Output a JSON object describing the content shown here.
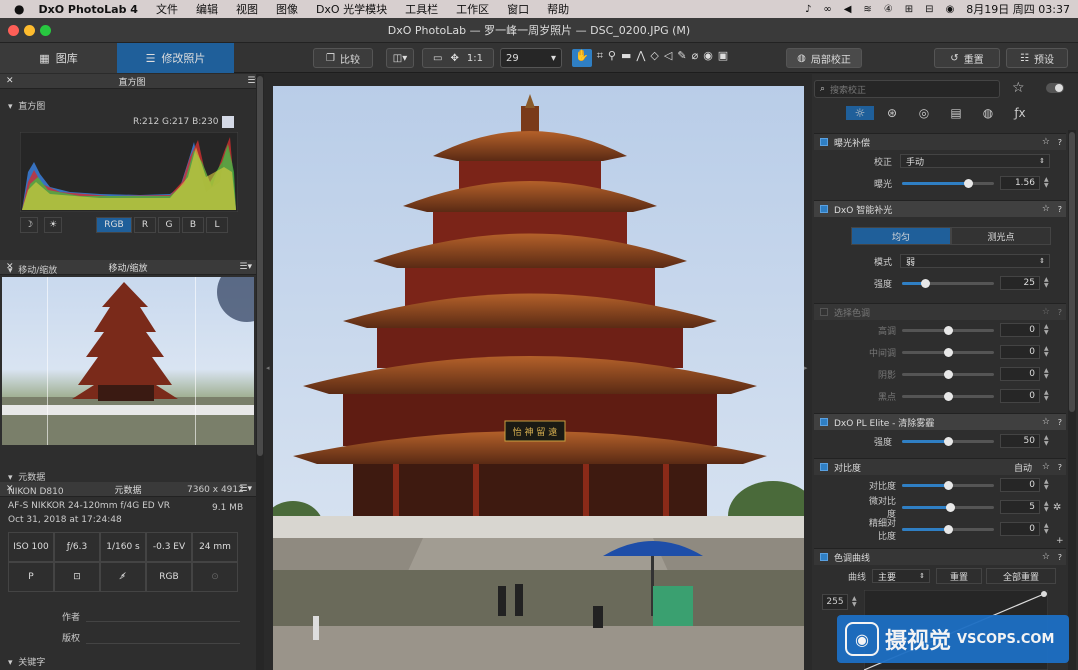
{
  "menubar": {
    "app_name": "DxO PhotoLab 4",
    "items": [
      "文件",
      "编辑",
      "视图",
      "图像",
      "DxO 光学模块",
      "工具栏",
      "工作区",
      "窗口",
      "帮助"
    ],
    "date_time": "8月19日 周四  03:37"
  },
  "window": {
    "title": "DxO PhotoLab — 罗一峰一周岁照片 — DSC_0200.JPG (M)"
  },
  "toolbar": {
    "tab_library": "图库",
    "tab_customize": "修改照片",
    "compare_label": "比较",
    "one_to_one": "1:1",
    "zoom_value": "29",
    "local_adjust_label": "局部校正",
    "reset_label": "重置",
    "preset_label": "预设"
  },
  "histogram_panel": {
    "title": "直方图",
    "section": "直方图",
    "rgb_readout": "R:212 G:217 B:230",
    "channels": [
      "RGB",
      "R",
      "G",
      "B",
      "L"
    ],
    "active_channel": "RGB"
  },
  "move_zoom_panel": {
    "title": "移动/缩放",
    "section": "移动/缩放"
  },
  "metadata_panel": {
    "title": "元数据",
    "section": "元数据",
    "camera": "NIKON D810",
    "dimensions": "7360 x 4912",
    "lens": "AF-S NIKKOR 24-120mm f/4G ED VR",
    "file_size": "9.1 MB",
    "date": "Oct 31, 2018 at 17:24:48",
    "exif": [
      "ISO 100",
      "ƒ/6.3",
      "1/160 s",
      "-0.3 EV",
      "24 mm"
    ],
    "exif_row2": [
      "P",
      "",
      "",
      "RGB",
      ""
    ],
    "author_label": "作者",
    "copyright_label": "版权",
    "keywords_label": "关键字"
  },
  "right_panel": {
    "search_placeholder": "搜索校正",
    "exposure": {
      "title": "曝光补偿",
      "correction_label": "校正",
      "correction_value": "手动",
      "exposure_label": "曝光",
      "exposure_value": "1.56",
      "exposure_pos": 0.72
    },
    "smart_lighting": {
      "title": "DxO 智能补光",
      "btn_uniform": "均匀",
      "btn_spot": "测光点",
      "mode_label": "模式",
      "mode_value": "弱",
      "strength_label": "强度",
      "strength_value": "25",
      "strength_pos": 0.25
    },
    "selective_tone": {
      "title": "选择色调",
      "rows": [
        {
          "label": "高调",
          "value": "0"
        },
        {
          "label": "中间调",
          "value": "0"
        },
        {
          "label": "阴影",
          "value": "0"
        },
        {
          "label": "黑点",
          "value": "0"
        }
      ]
    },
    "clearview": {
      "title": "DxO PL Elite - 清除雾霾",
      "strength_label": "强度",
      "strength_value": "50",
      "strength_pos": 0.5
    },
    "contrast": {
      "title": "对比度",
      "auto_label": "自动",
      "rows": [
        {
          "label": "对比度",
          "value": "0",
          "pos": 0.5
        },
        {
          "label": "微对比度",
          "value": "5",
          "pos": 0.52
        },
        {
          "label": "精细对比度",
          "value": "0",
          "pos": 0.5
        }
      ]
    },
    "tone_curve": {
      "title": "色调曲线",
      "curve_label": "曲线",
      "curve_value": "主要",
      "reset_label": "重置",
      "reset_all_label": "全部重置",
      "input_value": "255"
    }
  },
  "watermark": {
    "text_cn": "摄视觉",
    "text_en": "VSCOPS.COM"
  },
  "photo_sign": {
    "text": "怡 神 留 遠"
  }
}
